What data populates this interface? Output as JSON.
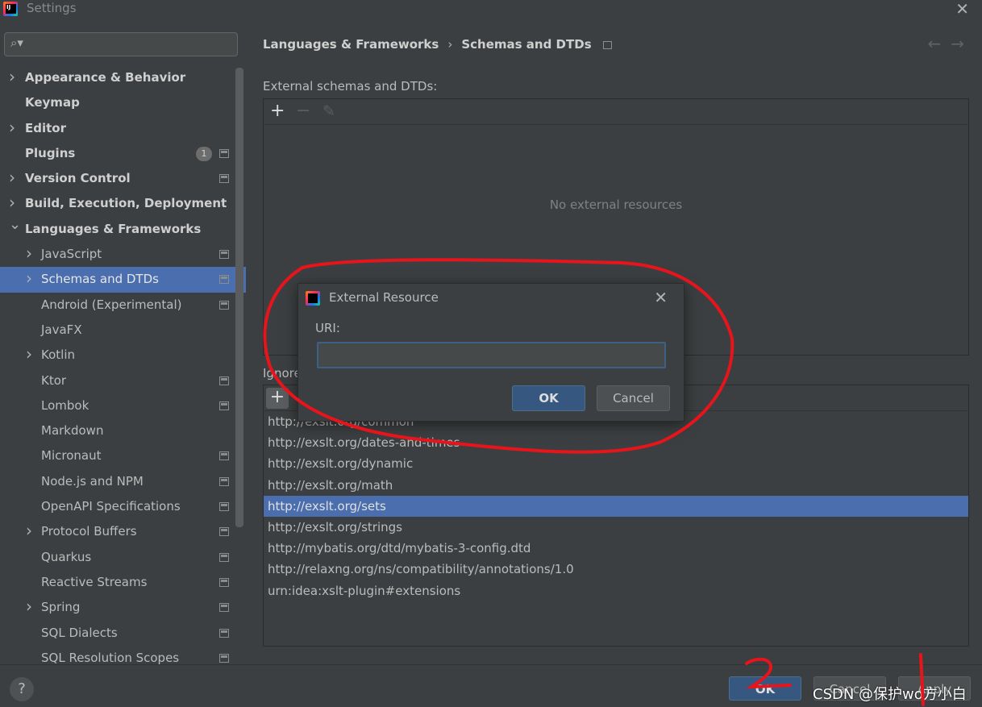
{
  "window": {
    "title": "Settings",
    "close_icon": "close-icon"
  },
  "search": {
    "placeholder": "",
    "value": ""
  },
  "sidebar": {
    "items": [
      {
        "label": "Appearance & Behavior",
        "level": 0,
        "chevron": "right",
        "selected": false,
        "project_icon": false
      },
      {
        "label": "Keymap",
        "level": 0,
        "chevron": "",
        "selected": false,
        "project_icon": false
      },
      {
        "label": "Editor",
        "level": 0,
        "chevron": "right",
        "selected": false,
        "project_icon": false
      },
      {
        "label": "Plugins",
        "level": 0,
        "chevron": "",
        "selected": false,
        "project_icon": true,
        "badge": "1"
      },
      {
        "label": "Version Control",
        "level": 0,
        "chevron": "right",
        "selected": false,
        "project_icon": true
      },
      {
        "label": "Build, Execution, Deployment",
        "level": 0,
        "chevron": "right",
        "selected": false,
        "project_icon": false
      },
      {
        "label": "Languages & Frameworks",
        "level": 0,
        "chevron": "down",
        "selected": false,
        "project_icon": false
      },
      {
        "label": "JavaScript",
        "level": 1,
        "chevron": "right",
        "selected": false,
        "project_icon": true
      },
      {
        "label": "Schemas and DTDs",
        "level": 1,
        "chevron": "right",
        "selected": true,
        "project_icon": true
      },
      {
        "label": "Android (Experimental)",
        "level": 1,
        "chevron": "",
        "selected": false,
        "project_icon": true
      },
      {
        "label": "JavaFX",
        "level": 1,
        "chevron": "",
        "selected": false,
        "project_icon": false
      },
      {
        "label": "Kotlin",
        "level": 1,
        "chevron": "right",
        "selected": false,
        "project_icon": false
      },
      {
        "label": "Ktor",
        "level": 1,
        "chevron": "",
        "selected": false,
        "project_icon": true
      },
      {
        "label": "Lombok",
        "level": 1,
        "chevron": "",
        "selected": false,
        "project_icon": true
      },
      {
        "label": "Markdown",
        "level": 1,
        "chevron": "",
        "selected": false,
        "project_icon": false
      },
      {
        "label": "Micronaut",
        "level": 1,
        "chevron": "",
        "selected": false,
        "project_icon": true
      },
      {
        "label": "Node.js and NPM",
        "level": 1,
        "chevron": "",
        "selected": false,
        "project_icon": true
      },
      {
        "label": "OpenAPI Specifications",
        "level": 1,
        "chevron": "",
        "selected": false,
        "project_icon": true
      },
      {
        "label": "Protocol Buffers",
        "level": 1,
        "chevron": "right",
        "selected": false,
        "project_icon": true
      },
      {
        "label": "Quarkus",
        "level": 1,
        "chevron": "",
        "selected": false,
        "project_icon": true
      },
      {
        "label": "Reactive Streams",
        "level": 1,
        "chevron": "",
        "selected": false,
        "project_icon": true
      },
      {
        "label": "Spring",
        "level": 1,
        "chevron": "right",
        "selected": false,
        "project_icon": true
      },
      {
        "label": "SQL Dialects",
        "level": 1,
        "chevron": "",
        "selected": false,
        "project_icon": true
      },
      {
        "label": "SQL Resolution Scopes",
        "level": 1,
        "chevron": "",
        "selected": false,
        "project_icon": true
      }
    ]
  },
  "breadcrumb": {
    "parent": "Languages & Frameworks",
    "separator": "›",
    "current": "Schemas and DTDs"
  },
  "nav": {
    "back": "←",
    "forward": "→"
  },
  "external": {
    "label": "External schemas and DTDs:",
    "toolbar": {
      "add": "+",
      "remove": "−",
      "edit": "✎"
    },
    "empty_text": "No external resources"
  },
  "ignored": {
    "label": "Ignore",
    "add": "+",
    "uris": [
      {
        "text": "http://exslt.org/common",
        "selected": false
      },
      {
        "text": "http://exslt.org/dates-and-times",
        "selected": false
      },
      {
        "text": "http://exslt.org/dynamic",
        "selected": false
      },
      {
        "text": "http://exslt.org/math",
        "selected": false
      },
      {
        "text": "http://exslt.org/sets",
        "selected": true
      },
      {
        "text": "http://exslt.org/strings",
        "selected": false
      },
      {
        "text": "http://mybatis.org/dtd/mybatis-3-config.dtd",
        "selected": false
      },
      {
        "text": "http://relaxng.org/ns/compatibility/annotations/1.0",
        "selected": false
      },
      {
        "text": "urn:idea:xslt-plugin#extensions",
        "selected": false
      }
    ]
  },
  "dialog": {
    "title": "External Resource",
    "uri_label": "URI:",
    "uri_value": "",
    "ok_label": "OK",
    "cancel_label": "Cancel"
  },
  "footer": {
    "help": "?",
    "ok_label": "OK",
    "cancel_label": "Cancel",
    "apply_label": "Apply",
    "watermark": "CSDN @保护wo方小白"
  },
  "annotations": {
    "number_1": "1",
    "number_2": "2",
    "color": "#e8141c"
  },
  "colors": {
    "selection": "#4b6eaf",
    "background": "#3c3f41",
    "primary_button": "#365880"
  }
}
